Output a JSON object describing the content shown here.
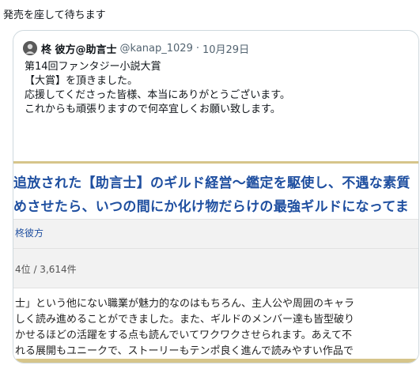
{
  "tweet": {
    "text": "発売を座して待ちます"
  },
  "quoted": {
    "author_name": "柊 彼方@助言士",
    "handle": "@kanap_1029",
    "separator": "·",
    "date": "10月29日",
    "lines": [
      "第14回ファンタジー小説大賞",
      "【大賞】を頂きました。",
      "応援してくださった皆様、本当にありがとうございます。",
      "これからも頑張りますので何卒宜しくお願い致します。"
    ],
    "image": {
      "title_lines": [
        "追放された【助言士】のギルド経営〜鑑定を駆使し、不遇な素質",
        "めさせたら、いつの間にか化け物だらけの最強ギルドになってま"
      ],
      "author": "柊彼方",
      "stats": "4位 / 3,614件",
      "review_lines": [
        "士」という他にない職業が魅力的なのはもちろん、主人公や周囲のキャラ",
        "しく読み進めることができました。また、ギルドのメンバー達も皆型破り",
        "かせるほどの活躍をする点も読んでいてワクワクさせられます。あえて不",
        "れる展開もユニークで、ストーリーもテンポ良く進んで読みやすい作品で"
      ]
    }
  },
  "colors": {
    "title_blue": "#1f4fa0",
    "gold": "#d6c58a",
    "muted": "#536471"
  }
}
